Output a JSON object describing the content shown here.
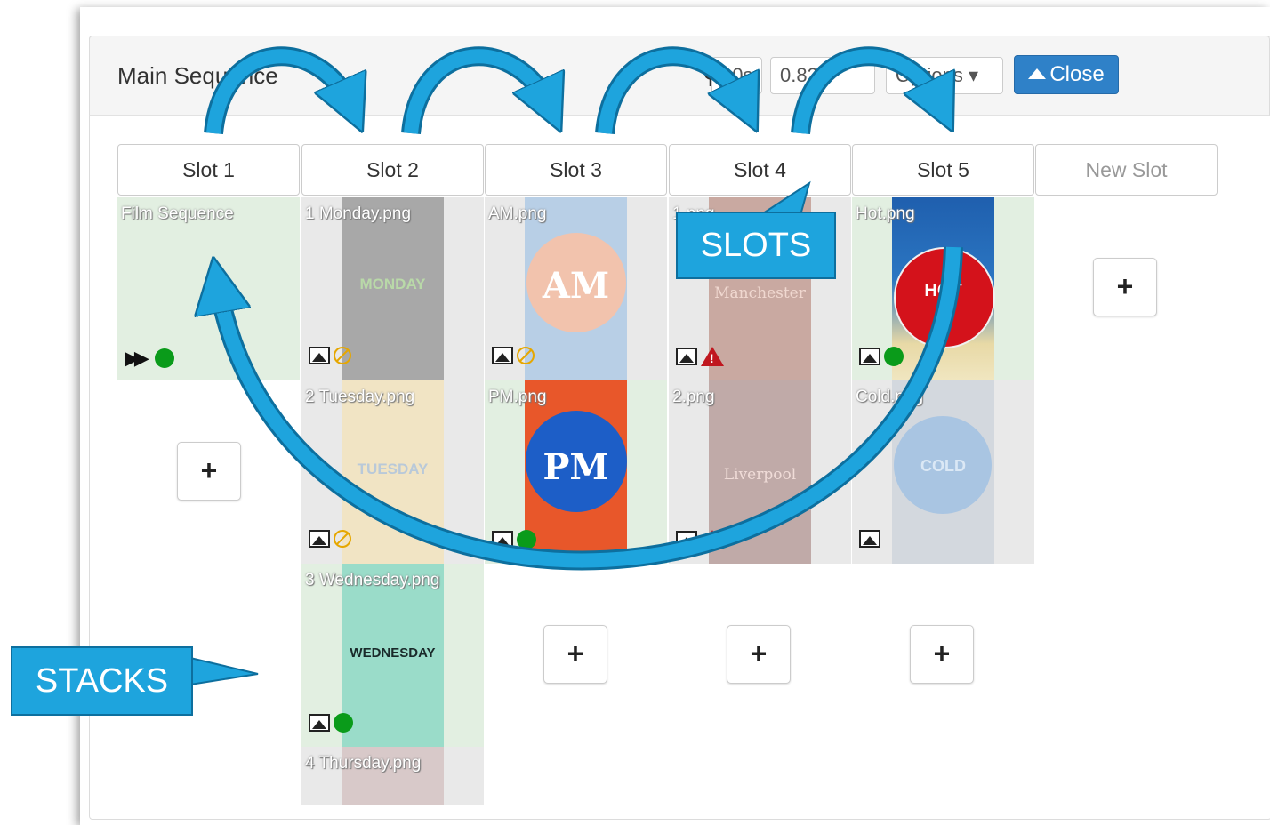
{
  "header": {
    "title": "Main Sequence",
    "duration": "10s",
    "ratio": "0.82",
    "options_label": "Options",
    "close_label": "Close"
  },
  "slots": [
    "Slot 1",
    "Slot 2",
    "Slot 3",
    "Slot 4",
    "Slot 5"
  ],
  "new_slot_label": "New Slot",
  "cells": {
    "s1c1": "Film Sequence",
    "s2c1": "1 Monday.png",
    "s2c2": "2 Tuesday.png",
    "s2c3": "3 Wednesday.png",
    "s2c4": "4 Thursday.png",
    "s3c1": "AM.png",
    "s3c2": "PM.png",
    "s4c1": "1.png",
    "s4c2": "2.png",
    "s5c1": "Hot.png",
    "s5c2": "Cold.png"
  },
  "thumb_text": {
    "monday": "MONDAY",
    "tuesday": "TUESDAY",
    "wednesday": "WEDNESDAY",
    "am": "AM",
    "pm": "PM",
    "manchester": "Manchester",
    "liverpool": "Liverpool",
    "hot": "HOT",
    "cold": "COLD"
  },
  "add_label": "+",
  "callouts": {
    "slots": "SLOTS",
    "stacks": "STACKS"
  },
  "colors": {
    "accent": "#1ea4dd",
    "close_button": "#2f81c8",
    "status_green": "#0a9b1a",
    "warning_red": "#c0171f"
  }
}
